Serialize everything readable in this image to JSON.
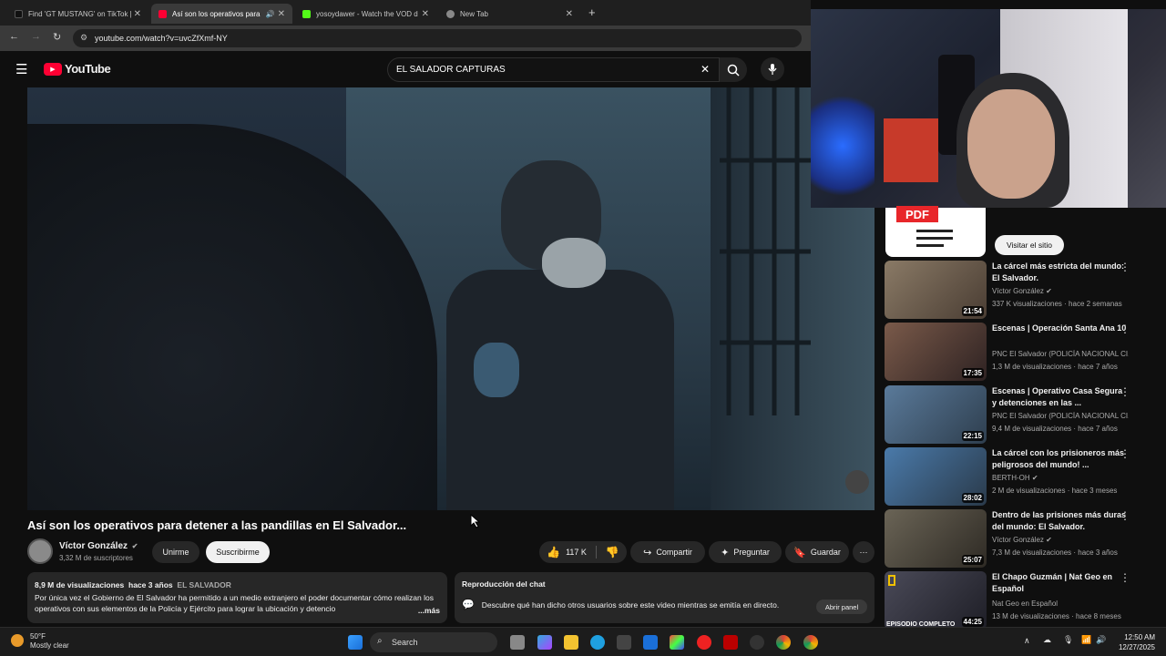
{
  "browser": {
    "tabs": [
      {
        "label": "Find 'GT MUSTANG' on TikTok |",
        "color": "#111111"
      },
      {
        "label": "Así son los operativos para",
        "color": "#ff0033"
      },
      {
        "label": "yosoydawer - Watch the VOD d",
        "color": "#53fc18"
      },
      {
        "label": "New Tab",
        "color": "#888888"
      }
    ],
    "url": "youtube.com/watch?v=uvcZfXmf-NY"
  },
  "youtube": {
    "logo_text": "YouTube",
    "search_value": "EL SALADOR CAPTURAS"
  },
  "video": {
    "title": "Así son los operativos para detener a las pandillas en El Salvador...",
    "channel": "Víctor González",
    "subscribers": "3,32 M de suscriptores",
    "join_label": "Unirme",
    "subscribe_label": "Suscribirme",
    "likes": "117 K",
    "share_label": "Compartir",
    "ask_label": "Preguntar",
    "save_label": "Guardar",
    "description": {
      "views": "8,9 M de visualizaciones",
      "age": "hace 3 años",
      "tag": "EL SALVADOR",
      "text": "Por única vez el Gobierno de El Salvador ha permitido a un medio extranjero el poder documentar cómo realizan los operativos con sus elementos de la Policía y Ejército para lograr la ubicación y detencio",
      "more": "...más"
    },
    "chat": {
      "title": "Reproducción del chat",
      "text": "Descubre qué han dicho otros usuarios sobre este video mientras se emitía en directo.",
      "button": "Abrir panel"
    }
  },
  "sidebar": {
    "ad": {
      "badge": "PDF",
      "visit_label": "Visitar el sitio"
    },
    "recommendations": [
      {
        "title": "La cárcel más estricta del mundo: El Salvador.",
        "channel": "Víctor González",
        "stats": "337 K visualizaciones · hace 2 semanas",
        "duration": "21:54",
        "thumb": "#6b5a4a"
      },
      {
        "title": "Escenas | Operación Santa Ana 10",
        "channel": "PNC El Salvador (POLICÍA NACIONAL CI...",
        "stats": "1,3 M de visualizaciones · hace 7 años",
        "duration": "17:35",
        "thumb": "#4a3a3a"
      },
      {
        "title": "Escenas | Operativo Casa Segura y detenciones en las ...",
        "channel": "PNC El Salvador (POLICÍA NACIONAL CI...",
        "stats": "9,4 M de visualizaciones · hace 7 años",
        "duration": "22:15",
        "thumb": "#3f5a70"
      },
      {
        "title": "La cárcel con los prisioneros más peligrosos del mundo! ...",
        "channel": "BERTH-OH",
        "stats": "2 M de visualizaciones · hace 3 meses",
        "duration": "28:02",
        "thumb": "#3b5a7a"
      },
      {
        "title": "Dentro de las prisiones más duras del mundo: El Salvador.",
        "channel": "Víctor González",
        "stats": "7,3 M de visualizaciones · hace 3 años",
        "duration": "25:07",
        "thumb": "#5a5448"
      },
      {
        "title": "El Chapo Guzmán | Nat Geo en Español",
        "channel": "Nat Geo en Español",
        "stats": "13 M de visualizaciones · hace 8 meses",
        "duration": "44:25",
        "thumb": "#3a3a44",
        "label": "EPISODIO COMPLETO"
      }
    ]
  },
  "taskbar": {
    "weather_temp": "50°F",
    "weather_text": "Mostly clear",
    "search_label": "Search",
    "time": "12:50 AM",
    "date": "12/27/2025"
  }
}
